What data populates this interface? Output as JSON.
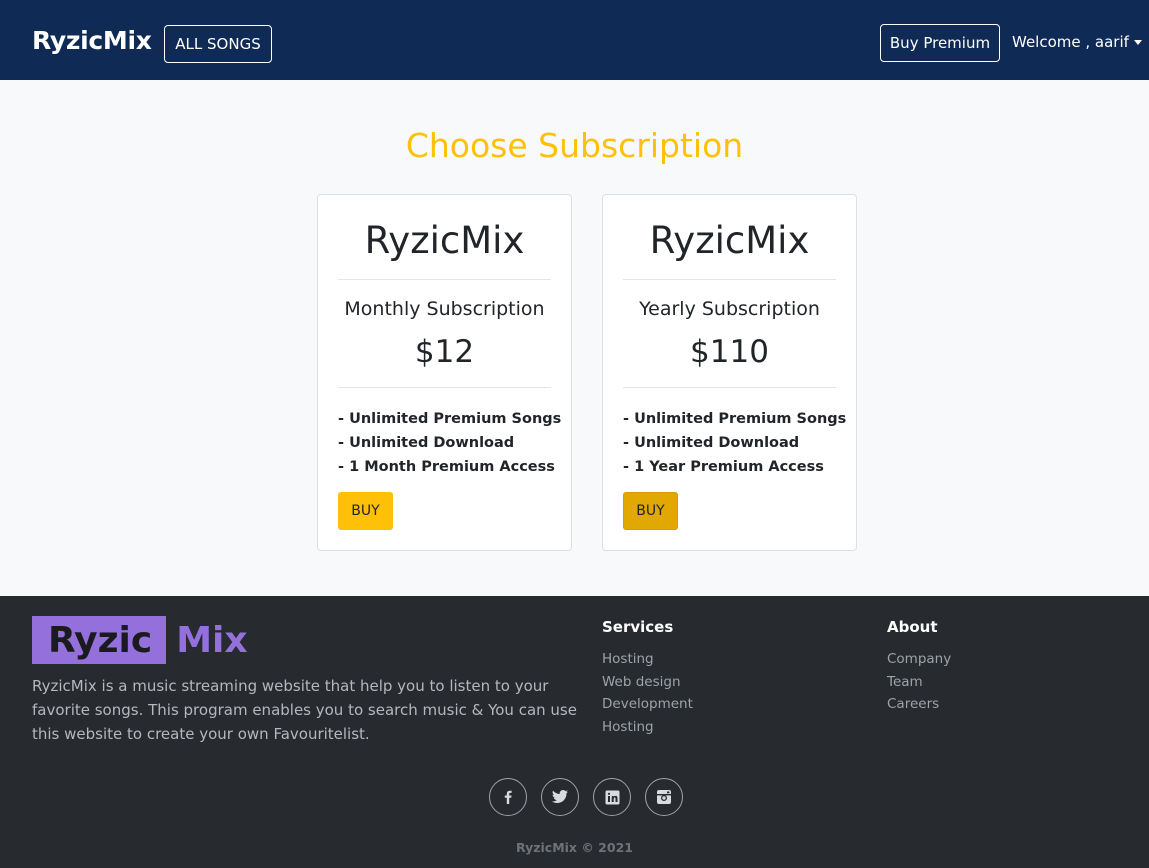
{
  "navbar": {
    "brand": "RyzicMix",
    "all_songs_label": "ALL SONGS",
    "buy_premium_label": "Buy Premium",
    "welcome_label": "Welcome , aarif"
  },
  "main": {
    "title": "Choose Subscription",
    "plans": [
      {
        "brand": "RyzicMix",
        "name": "Monthly Subscription",
        "price": "$12",
        "features": [
          "- Unlimited Premium Songs",
          "- Unlimited Download",
          "- 1 Month Premium Access"
        ],
        "buy_label": "BUY"
      },
      {
        "brand": "RyzicMix",
        "name": "Yearly Subscription",
        "price": "$110",
        "features": [
          "- Unlimited Premium Songs",
          "- Unlimited Download",
          "- 1 Year Premium Access"
        ],
        "buy_label": "BUY"
      }
    ]
  },
  "footer": {
    "logo_part1": "Ryzic",
    "logo_part2": "Mix",
    "description": "RyzicMix is a music streaming website that help you to listen to your favorite songs. This program enables you to search music & You can use this website to create your own Favouritelist.",
    "services": {
      "title": "Services",
      "links": [
        "Hosting",
        "Web design",
        "Development",
        "Hosting"
      ]
    },
    "about": {
      "title": "About",
      "links": [
        "Company",
        "Team",
        "Careers"
      ]
    },
    "socials": [
      "facebook-icon",
      "twitter-icon",
      "linkedin-icon",
      "instagram-icon"
    ],
    "copyright": "RyzicMix © 2021"
  },
  "colors": {
    "navbar_bg": "#0f2a55",
    "accent": "#ffc107",
    "accent_hover": "#e0a800",
    "logo_purple": "#9370db",
    "footer_bg": "#272b30"
  }
}
